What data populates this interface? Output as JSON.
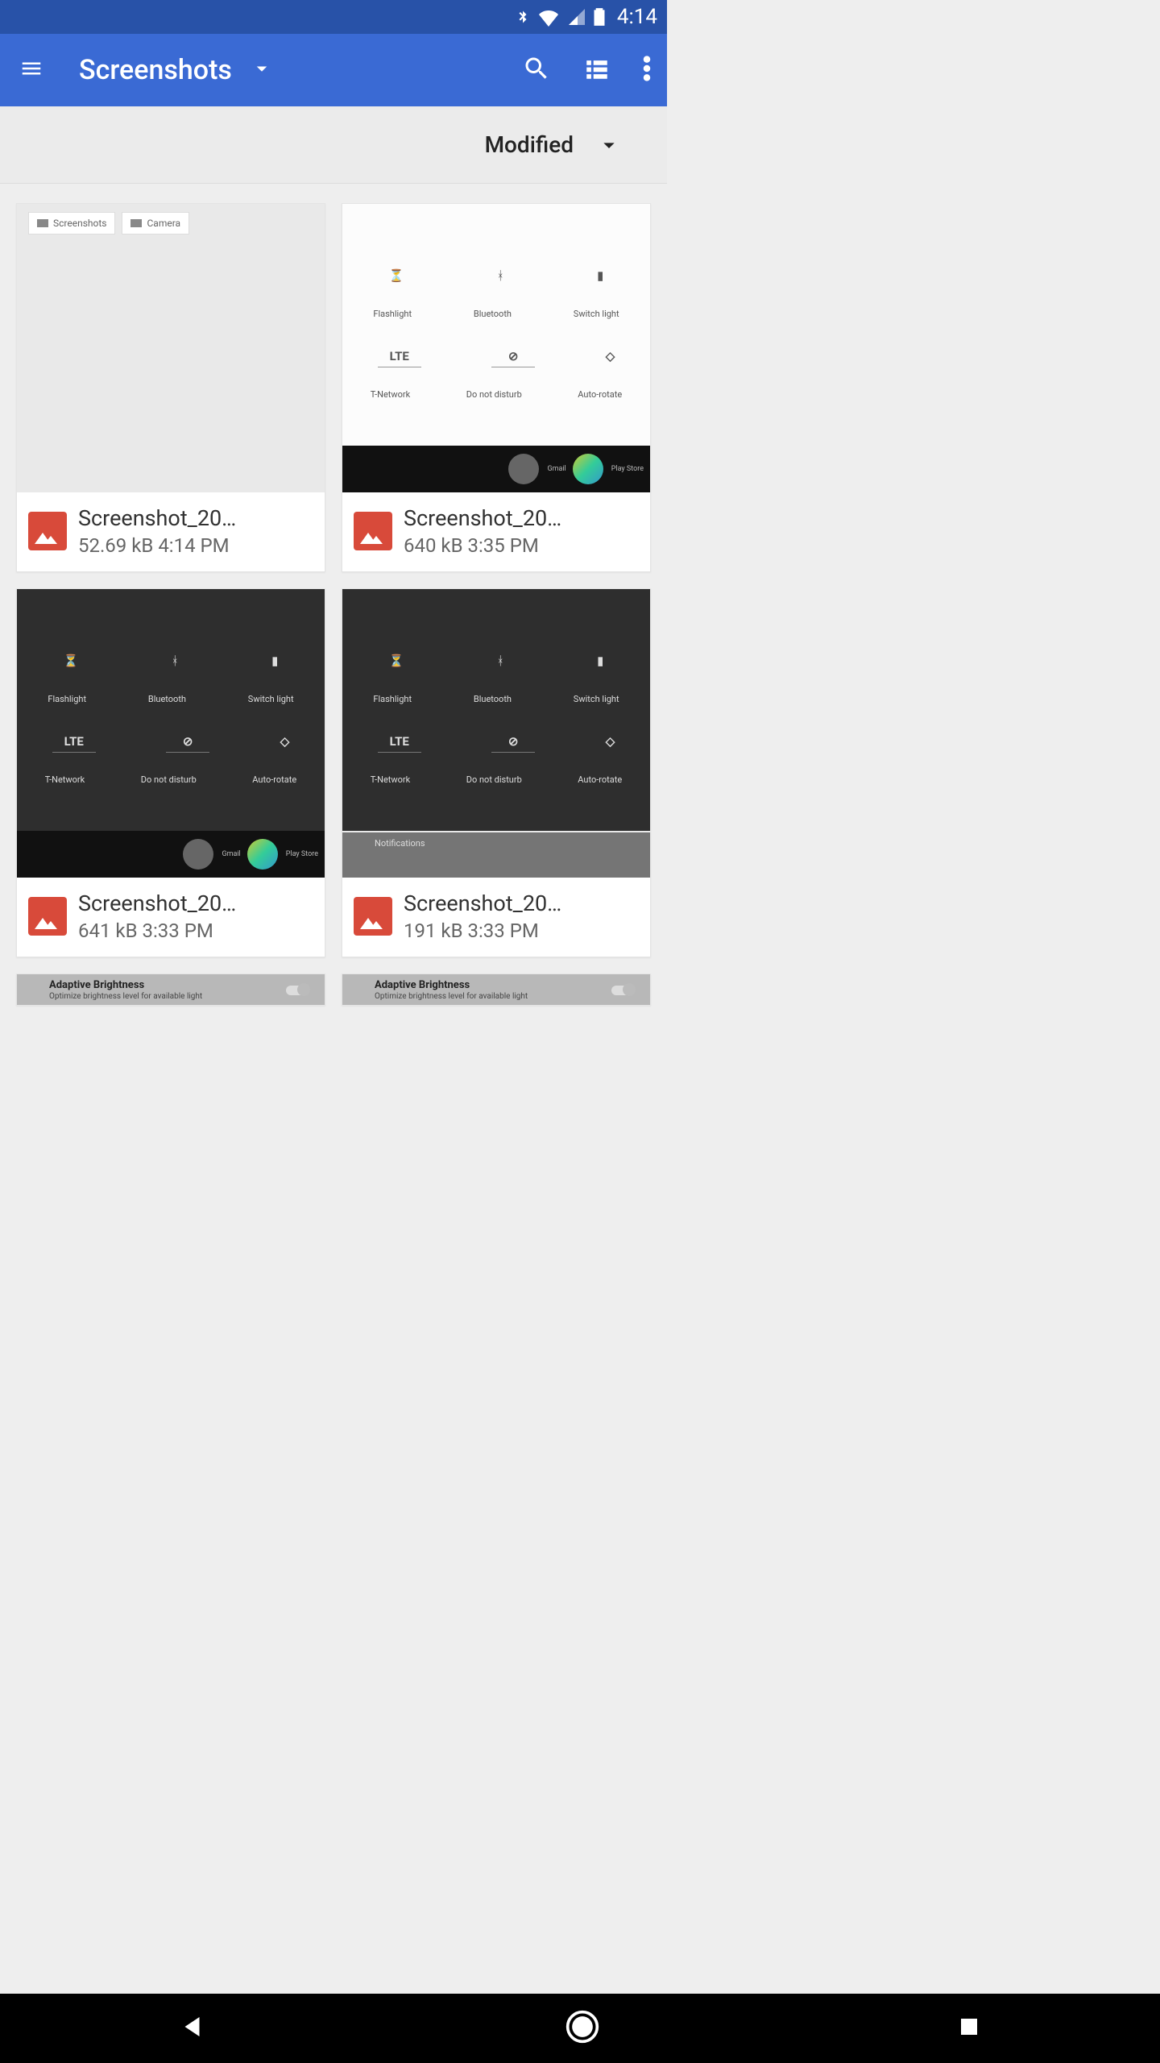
{
  "status": {
    "time": "4:14"
  },
  "appbar": {
    "title": "Screenshots"
  },
  "sort": {
    "label": "Modified"
  },
  "thumbs": {
    "qs_labels_top": [
      "",
      "",
      ""
    ],
    "qs_labels_mid": [
      "Flashlight",
      "Bluetooth",
      "Switch light"
    ],
    "qs_labels_lte": [
      "T-Network",
      "Do not disturb",
      "Auto-rotate"
    ],
    "chip1": "Screenshots",
    "chip2": "Camera",
    "lte": "LTE",
    "circ1": "Gmail",
    "circ2": "Play Store",
    "adaptive": "Adaptive Brightness",
    "adaptive_sub": "Optimize brightness level for available light",
    "notifications": "Notifications"
  },
  "files": [
    {
      "name": "Screenshot_20…",
      "size": "52.69 kB",
      "time": "4:14 PM"
    },
    {
      "name": "Screenshot_20…",
      "size": "640 kB",
      "time": "3:35 PM"
    },
    {
      "name": "Screenshot_20…",
      "size": "641 kB",
      "time": "3:33 PM"
    },
    {
      "name": "Screenshot_20…",
      "size": "191 kB",
      "time": "3:33 PM"
    }
  ]
}
